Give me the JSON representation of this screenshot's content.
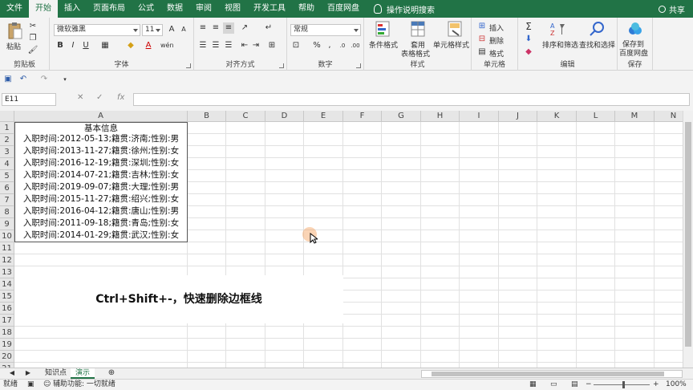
{
  "tabs": [
    {
      "label": "文件",
      "name": "tab-file"
    },
    {
      "label": "开始",
      "name": "tab-home"
    },
    {
      "label": "插入",
      "name": "tab-insert"
    },
    {
      "label": "页面布局",
      "name": "tab-page-layout"
    },
    {
      "label": "公式",
      "name": "tab-formulas"
    },
    {
      "label": "数据",
      "name": "tab-data"
    },
    {
      "label": "审阅",
      "name": "tab-review"
    },
    {
      "label": "视图",
      "name": "tab-view"
    },
    {
      "label": "开发工具",
      "name": "tab-developer"
    },
    {
      "label": "帮助",
      "name": "tab-help"
    },
    {
      "label": "百度网盘",
      "name": "tab-baidu"
    }
  ],
  "tell_me": "操作说明搜索",
  "share": "共享",
  "ribbon": {
    "clipboard": {
      "paste": "粘贴",
      "label": "剪贴板"
    },
    "font": {
      "name": "微软雅黑",
      "size": "11",
      "label": "字体"
    },
    "alignment": {
      "label": "对齐方式"
    },
    "number": {
      "format": "常规",
      "label": "数字"
    },
    "styles": {
      "conditional": "条件格式",
      "table1": "套用",
      "table2": "表格格式",
      "cell_styles": "单元格样式",
      "label": "样式"
    },
    "cells": {
      "insert": "插入",
      "delete": "删除",
      "format": "格式",
      "label": "单元格"
    },
    "editing": {
      "sort": "排序和筛选",
      "find": "查找和选择",
      "label": "编辑"
    },
    "save": {
      "line1": "保存到",
      "line2": "百度网盘",
      "label": "保存"
    }
  },
  "name_box": "E11",
  "columns": [
    "A",
    "B",
    "C",
    "D",
    "E",
    "F",
    "G",
    "H",
    "I",
    "J",
    "K",
    "L",
    "M",
    "N"
  ],
  "rows": [
    "1",
    "2",
    "3",
    "4",
    "5",
    "6",
    "7",
    "8",
    "9",
    "10",
    "11",
    "12",
    "13",
    "14",
    "15",
    "16",
    "17",
    "18",
    "19",
    "20",
    "21"
  ],
  "cells": [
    "基本信息",
    "入职时间:2012-05-13;籍贯:济南;性别:男",
    "入职时间:2013-11-27;籍贯:徐州;性别:女",
    "入职时间:2016-12-19;籍贯:深圳;性别:女",
    "入职时间:2014-07-21;籍贯:吉林;性别:女",
    "入职时间:2019-09-07;籍贯:大理;性别:男",
    "入职时间:2015-11-27;籍贯:绍兴;性别:女",
    "入职时间:2016-04-12;籍贯:唐山;性别:男",
    "入职时间:2011-09-18;籍贯:青岛;性别:女",
    "入职时间:2014-01-29;籍贯:武汉;性别:女"
  ],
  "overlay_text": "Ctrl+Shift+-，快速删除边框线",
  "sheets": [
    "知识点",
    "演示"
  ],
  "status": {
    "mode": "就绪",
    "accessibility": "辅助功能: 一切就绪",
    "zoom": "100%"
  },
  "colors": {
    "brand": "#217346"
  }
}
